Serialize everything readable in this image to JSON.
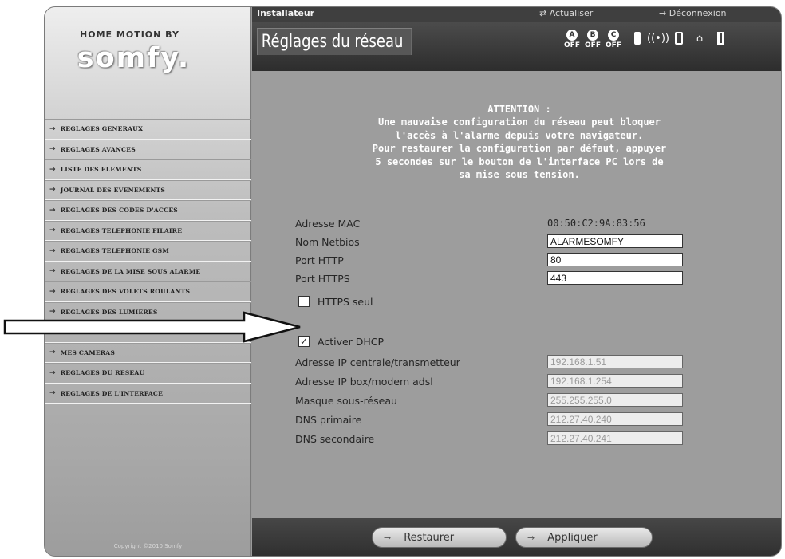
{
  "brand": {
    "top": "HOME MOTION BY",
    "logo": "somfy."
  },
  "sidebar": {
    "items": [
      "REGLAGES GENERAUX",
      "REGLAGES AVANCES",
      "LISTE DES ELEMENTS",
      "JOURNAL DES EVENEMENTS",
      "REGLAGES DES CODES D'ACCES",
      "REGLAGES TELEPHONIE FILAIRE",
      "REGLAGES TELEPHONIE GSM",
      "REGLAGES DE LA MISE SOUS ALARME",
      "REGLAGES DES VOLETS ROULANTS",
      "REGLAGES DES LUMIERES",
      "",
      "MES CAMERAS",
      "REGLAGES DU RESEAU",
      "REGLAGES DE L'INTERFACE"
    ],
    "copyright": "Copyright ©2010 Somfy"
  },
  "topbar": {
    "role": "Installateur",
    "refresh": "Actualiser",
    "logout": "Déconnexion"
  },
  "page": {
    "title": "Réglages du réseau"
  },
  "status": {
    "zones": [
      {
        "letter": "A",
        "state": "OFF"
      },
      {
        "letter": "B",
        "state": "OFF"
      },
      {
        "letter": "C",
        "state": "OFF"
      }
    ],
    "icons": [
      "battery-icon",
      "radio-signal-icon",
      "box-icon",
      "home-icon",
      "plug-icon"
    ]
  },
  "attention": [
    "ATTENTION :",
    "Une mauvaise configuration du réseau peut bloquer",
    "l'accès à l'alarme depuis votre navigateur.",
    "Pour restaurer la configuration par défaut, appuyer",
    "5 secondes sur le bouton de l'interface PC lors de",
    "sa mise sous tension."
  ],
  "form": {
    "mac": {
      "label": "Adresse MAC",
      "value": "00:50:C2:9A:83:56"
    },
    "netbios": {
      "label": "Nom Netbios",
      "value": "ALARMESOMFY"
    },
    "http": {
      "label": "Port HTTP",
      "value": "80"
    },
    "https": {
      "label": "Port HTTPS",
      "value": "443"
    },
    "https_only": {
      "label": "HTTPS seul",
      "checked": false
    },
    "dhcp": {
      "label": "Activer DHCP",
      "checked": true
    },
    "ip_central": {
      "label": "Adresse IP centrale/transmetteur",
      "value": "192.168.1.51"
    },
    "ip_box": {
      "label": "Adresse IP box/modem adsl",
      "value": "192.168.1.254"
    },
    "mask": {
      "label": "Masque sous-réseau",
      "value": "255.255.255.0"
    },
    "dns1": {
      "label": "DNS primaire",
      "value": "212.27.40.240"
    },
    "dns2": {
      "label": "DNS secondaire",
      "value": "212.27.40.241"
    }
  },
  "footer": {
    "restore": "Restaurer",
    "apply": "Appliquer"
  },
  "colors": {
    "background": "#9d9d9d",
    "bar": "#3f3f3f",
    "text": "#262626"
  }
}
